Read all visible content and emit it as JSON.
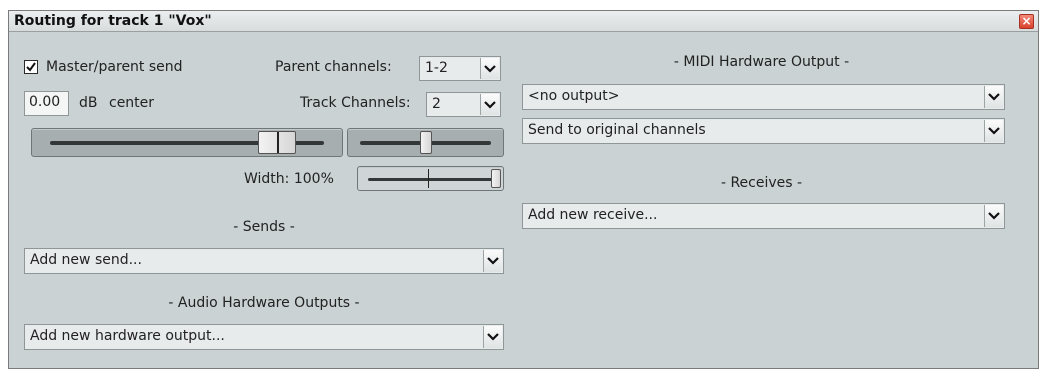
{
  "window": {
    "title": "Routing for track 1 \"Vox\"",
    "close_glyph": "×"
  },
  "master_send": {
    "label": "Master/parent send",
    "checked": true
  },
  "parent_channels": {
    "label": "Parent channels:",
    "value": "1-2"
  },
  "volume": {
    "value": "0.00",
    "unit": "dB",
    "pan_text": "center"
  },
  "track_channels": {
    "label": "Track Channels:",
    "value": "2"
  },
  "width": {
    "label": "Width: 100%",
    "level": 1.0
  },
  "sends": {
    "heading": "- Sends -",
    "select_value": "Add new send..."
  },
  "audio_hw": {
    "heading": "- Audio Hardware Outputs -",
    "select_value": "Add new hardware output..."
  },
  "midi_hw": {
    "heading": "- MIDI Hardware Output -",
    "output_value": "<no output>",
    "channels_value": "Send to original channels"
  },
  "receives": {
    "heading": "- Receives -",
    "select_value": "Add new receive..."
  }
}
